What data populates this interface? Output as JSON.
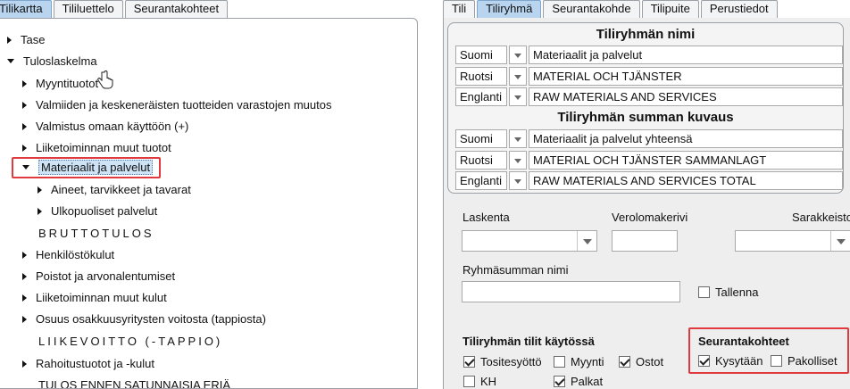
{
  "left_tabs": [
    "Tilikartta",
    "Tililuettelo",
    "Seurantakohteet"
  ],
  "right_tabs": [
    "Tili",
    "Tiliryhmä",
    "Seurantakohde",
    "Tilipuite",
    "Perustiedot"
  ],
  "tree": {
    "items": [
      {
        "label": "Tase",
        "expander": "collapsed",
        "level": 0
      },
      {
        "label": "Tuloslaskelma",
        "expander": "expanded",
        "level": 0
      },
      {
        "label": "Myyntituotot",
        "expander": "collapsed",
        "level": 1
      },
      {
        "label": "Valmiiden ja keskeneräisten tuotteiden varastojen muutos",
        "expander": "collapsed",
        "level": 1
      },
      {
        "label": "Valmistus omaan käyttöön (+)",
        "expander": "collapsed",
        "level": 1
      },
      {
        "label": "Liiketoiminnan muut tuotot",
        "expander": "collapsed",
        "level": 1
      },
      {
        "label": "Materiaalit ja palvelut",
        "expander": "expanded",
        "level": 1,
        "selected": true
      },
      {
        "label": "Aineet, tarvikkeet ja tavarat",
        "expander": "collapsed",
        "level": 2
      },
      {
        "label": "Ulkopuoliset palvelut",
        "expander": "collapsed",
        "level": 2
      },
      {
        "label": "BRUTTOTULOS",
        "expander": "none",
        "level": 1
      },
      {
        "label": "Henkilöstökulut",
        "expander": "collapsed",
        "level": 1
      },
      {
        "label": "Poistot ja arvonalentumiset",
        "expander": "collapsed",
        "level": 1
      },
      {
        "label": "Liiketoiminnan muut kulut",
        "expander": "collapsed",
        "level": 1
      },
      {
        "label": "Osuus osakkuusyritysten voitosta (tappiosta)",
        "expander": "collapsed",
        "level": 1
      },
      {
        "label": "LIIKEVOITTO (-TAPPIO)",
        "expander": "none",
        "level": 1
      },
      {
        "label": "Rahoitustuotot ja -kulut",
        "expander": "collapsed",
        "level": 1
      },
      {
        "label": "TULOS ENNEN SATUNNAISIA ERIÄ",
        "expander": "none",
        "level": 1
      }
    ]
  },
  "group_name": {
    "title": "Tiliryhmän nimi",
    "rows": [
      {
        "language": "Suomi",
        "value": "Materiaalit ja palvelut"
      },
      {
        "language": "Ruotsi",
        "value": "MATERIAL OCH TJÄNSTER"
      },
      {
        "language": "Englanti",
        "value": "RAW MATERIALS AND SERVICES"
      }
    ]
  },
  "sum_description": {
    "title": "Tiliryhmän summan kuvaus",
    "rows": [
      {
        "language": "Suomi",
        "value": "Materiaalit ja palvelut yhteensä"
      },
      {
        "language": "Ruotsi",
        "value": "MATERIAL OCH TJÄNSTER SAMMANLAGT"
      },
      {
        "language": "Englanti",
        "value": "RAW MATERIALS AND SERVICES TOTAL"
      }
    ]
  },
  "fields": {
    "laskenta_label": "Laskenta",
    "laskenta_value": "",
    "verolomake_label": "Verolomakerivi",
    "verolomake_value": "",
    "sarakkeisto_label": "Sarakkeisto",
    "sarakkeisto_value": "",
    "ryhmasumma_label": "Ryhmäsumman nimi",
    "ryhmasumma_value": "",
    "tallenna_label": "Tallenna"
  },
  "accounts_in_use": {
    "title": "Tiliryhmän tilit käytössä",
    "items": [
      {
        "label": "Tositesyöttö",
        "checked": true
      },
      {
        "label": "Myynti",
        "checked": false
      },
      {
        "label": "Ostot",
        "checked": true
      },
      {
        "label": "KH",
        "checked": false
      },
      {
        "label": "Palkat",
        "checked": true
      }
    ]
  },
  "tracking": {
    "title": "Seurantakohteet",
    "items": [
      {
        "label": "Kysytään",
        "checked": true
      },
      {
        "label": "Pakolliset",
        "checked": false
      }
    ]
  },
  "colors": {
    "highlight_red": "#e0393e",
    "active_tab": "#b8d4ef",
    "panel_bg": "#eeeeee"
  }
}
